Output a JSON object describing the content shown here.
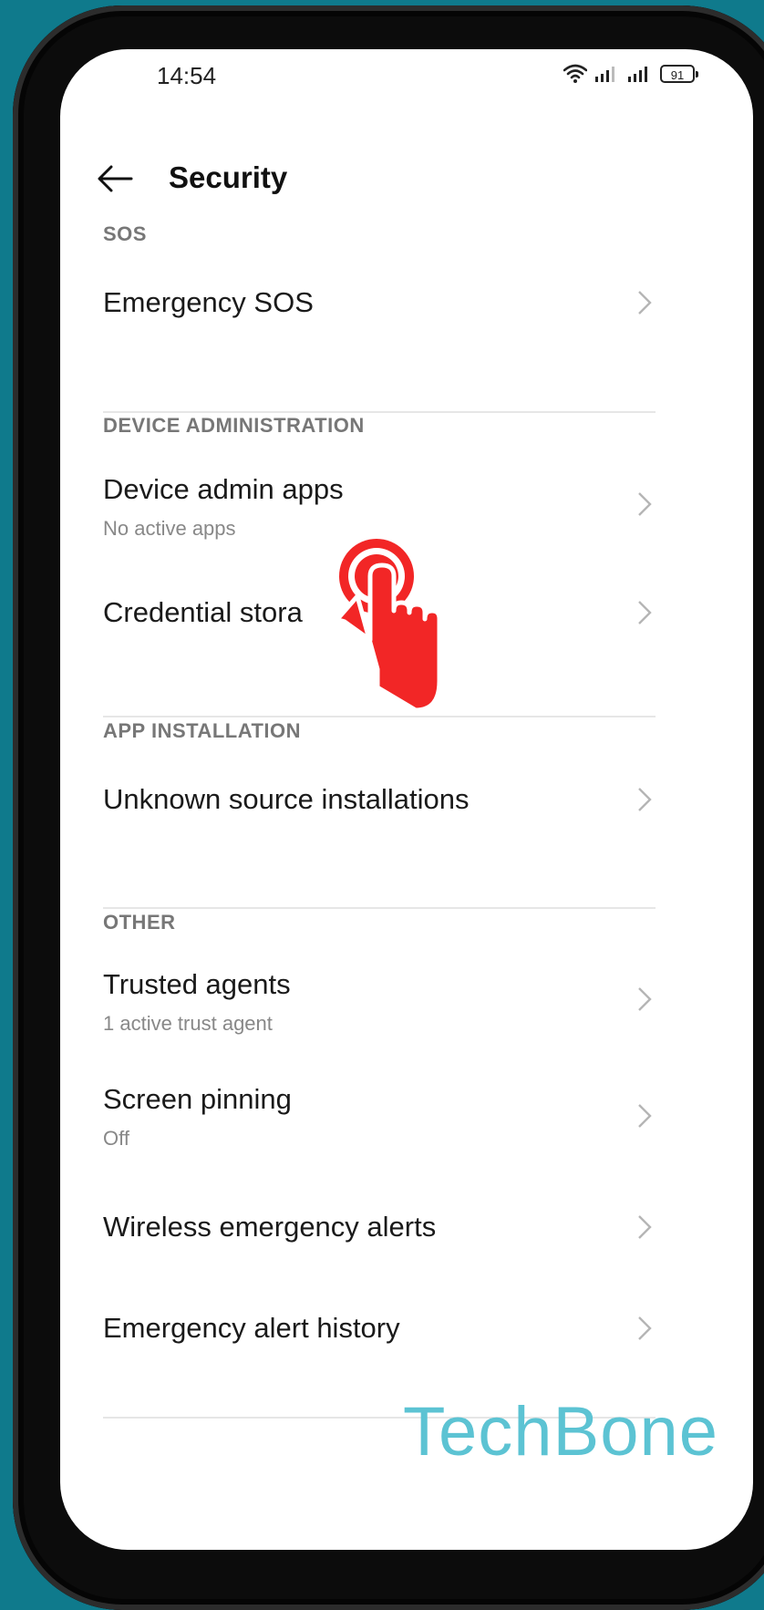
{
  "status_bar": {
    "time": "14:54",
    "battery": "91"
  },
  "header": {
    "title": "Security"
  },
  "sections": {
    "sos": {
      "title": "SOS",
      "items": [
        {
          "label": "Emergency SOS",
          "sub": ""
        }
      ]
    },
    "device_admin": {
      "title": "DEVICE ADMINISTRATION",
      "items": [
        {
          "label": "Device admin apps",
          "sub": "No active apps"
        },
        {
          "label": "Credential stora",
          "sub": ""
        }
      ]
    },
    "app_installation": {
      "title": "APP INSTALLATION",
      "items": [
        {
          "label": "Unknown source installations",
          "sub": ""
        }
      ]
    },
    "other": {
      "title": "OTHER",
      "items": [
        {
          "label": "Trusted agents",
          "sub": "1 active trust agent"
        },
        {
          "label": "Screen pinning",
          "sub": "Off"
        },
        {
          "label": "Wireless emergency alerts",
          "sub": ""
        },
        {
          "label": "Emergency alert history",
          "sub": ""
        }
      ]
    }
  },
  "watermark": "TechBone",
  "colors": {
    "background": "#0f7a8c",
    "tap_indicator": "#f22626",
    "watermark": "#5cc3d3"
  },
  "icons": [
    "wifi-icon",
    "signal-icon",
    "battery-icon",
    "back-arrow-icon",
    "chevron-right-icon",
    "tap-hand-icon"
  ]
}
